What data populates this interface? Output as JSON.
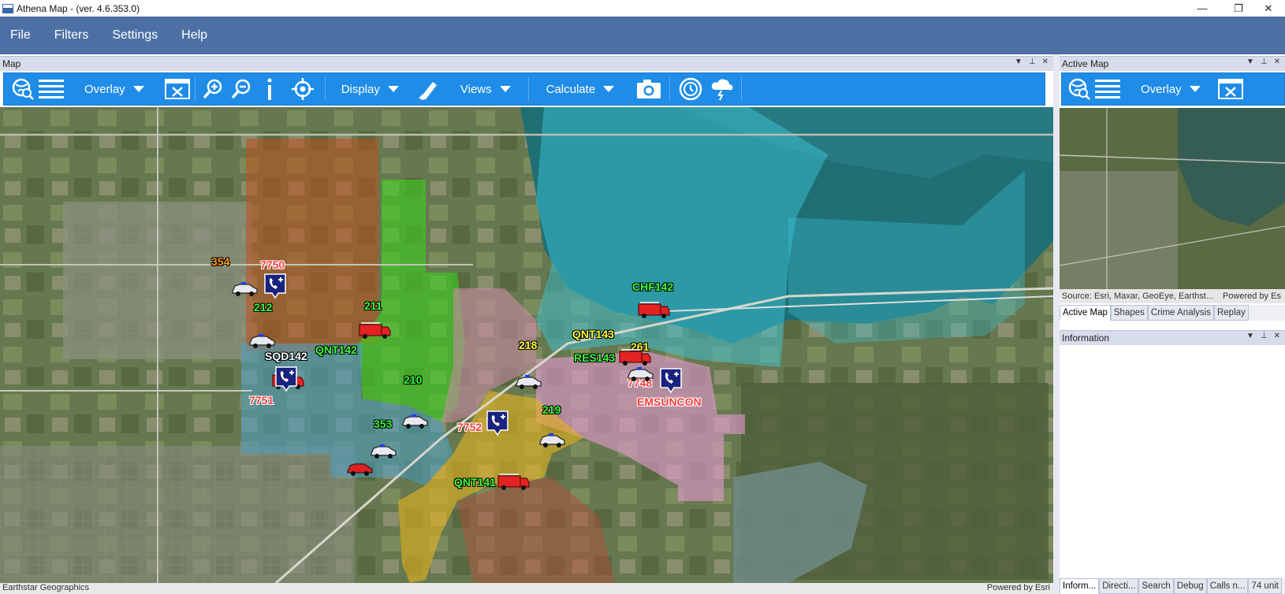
{
  "window": {
    "title": "Athena Map - (ver. 4.6.353.0)",
    "controls": [
      "—",
      "❐",
      "✕"
    ]
  },
  "menu": [
    "File",
    "Filters",
    "Settings",
    "Help"
  ],
  "map_panel": {
    "title": "Map",
    "toolbar": {
      "overlay": "Overlay",
      "display": "Display",
      "views": "Views",
      "calculate": "Calculate"
    },
    "attribution_left": "Earthstar Geographics",
    "attribution_right": "Powered by Esri"
  },
  "zones": [
    {
      "name": "orange",
      "color": "#c0501e"
    },
    {
      "name": "green",
      "color": "#3bd21e"
    },
    {
      "name": "blue",
      "color": "#4aa0c8"
    },
    {
      "name": "cyan",
      "color": "#3cc3d8"
    },
    {
      "name": "pink",
      "color": "#e69bd2"
    },
    {
      "name": "yellow",
      "color": "#e6b41e"
    },
    {
      "name": "rose",
      "color": "#c88aa4"
    }
  ],
  "labels": {
    "l354": "354",
    "l7750": "7750",
    "l212": "212",
    "l211": "211",
    "lSQD142": "SQD142",
    "lQNT142": "QNT142",
    "l7751": "7751",
    "l210": "210",
    "l353": "353",
    "l218": "218",
    "lQNT143": "QNT143",
    "l261": "261",
    "lRES143": "RES143",
    "l7748": "7748",
    "lEMSUNCON": "EMSUNCON",
    "lCHF142": "CHF142",
    "l219": "219",
    "l7752": "7752",
    "lQNT141": "QNT141"
  },
  "active_map_panel": {
    "title": "Active Map",
    "toolbar": {
      "overlay": "Overlay"
    },
    "source": "Source: Esri, Maxar, GeoEye, Earthst...",
    "powered": "Powered by Es",
    "tabs": [
      "Active Map",
      "Shapes",
      "Crime Analysis",
      "Replay"
    ]
  },
  "information_panel": {
    "title": "Information",
    "tabs": [
      "Inform...",
      "Directi...",
      "Search",
      "Debug",
      "Calls n...",
      "74 unit"
    ]
  }
}
